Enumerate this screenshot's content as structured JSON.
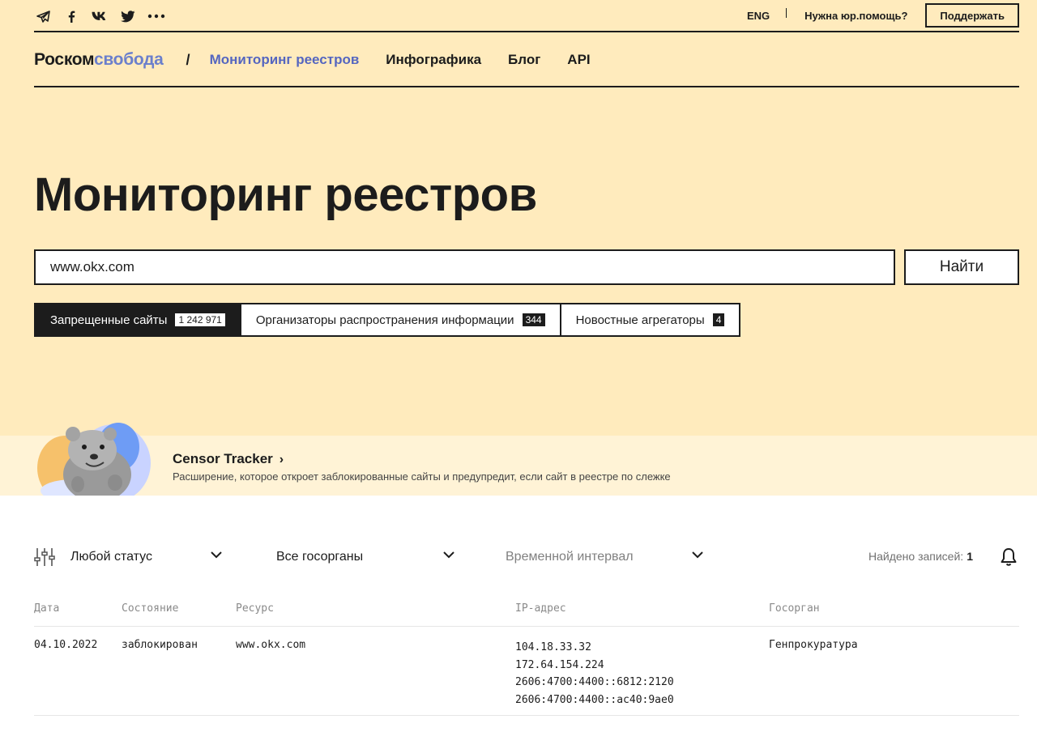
{
  "header": {
    "social_icons": [
      "telegram-icon",
      "facebook-icon",
      "vk-icon",
      "twitter-icon",
      "more-icon"
    ],
    "lang": "ENG",
    "legal_help": "Нужна юр.помощь?",
    "support_button": "Поддержать"
  },
  "nav": {
    "logo_part1": "Роском",
    "logo_part2": "свобода",
    "separator": "/",
    "items": [
      {
        "label": "Мониторинг реестров",
        "active": true
      },
      {
        "label": "Инфографика"
      },
      {
        "label": "Блог"
      },
      {
        "label": "API"
      }
    ]
  },
  "page": {
    "title": "Мониторинг реестров"
  },
  "search": {
    "value": "www.okx.com",
    "button": "Найти"
  },
  "tabs": [
    {
      "label": "Запрещенные сайты",
      "count": "1 242 971",
      "active": true
    },
    {
      "label": "Организаторы распространения информации",
      "count": "344"
    },
    {
      "label": "Новостные агрегаторы",
      "count": "4"
    }
  ],
  "promo": {
    "title": "Censor Tracker",
    "description": "Расширение, которое откроет заблокированные сайты и предупредит, если сайт в реестре по слежке"
  },
  "filters": {
    "status": "Любой статус",
    "org": "Все госорганы",
    "time": "Временной интервал",
    "found_label": "Найдено записей:",
    "found_count": "1"
  },
  "table": {
    "headers": {
      "date": "Дата",
      "state": "Состояние",
      "resource": "Ресурс",
      "ip": "IP-адрес",
      "org": "Госорган"
    },
    "rows": [
      {
        "date": "04.10.2022",
        "state": "заблокирован",
        "resource": "www.okx.com",
        "ips": [
          "104.18.33.32",
          "172.64.154.224",
          "2606:4700:4400::6812:2120",
          "2606:4700:4400::ac40:9ae0"
        ],
        "org": "Генпрокуратура"
      }
    ]
  },
  "colors": {
    "hero_bg": "#ffebbd",
    "promo_bg": "#fff3d6",
    "accent": "#5566c0",
    "text": "#1c1c1c"
  }
}
